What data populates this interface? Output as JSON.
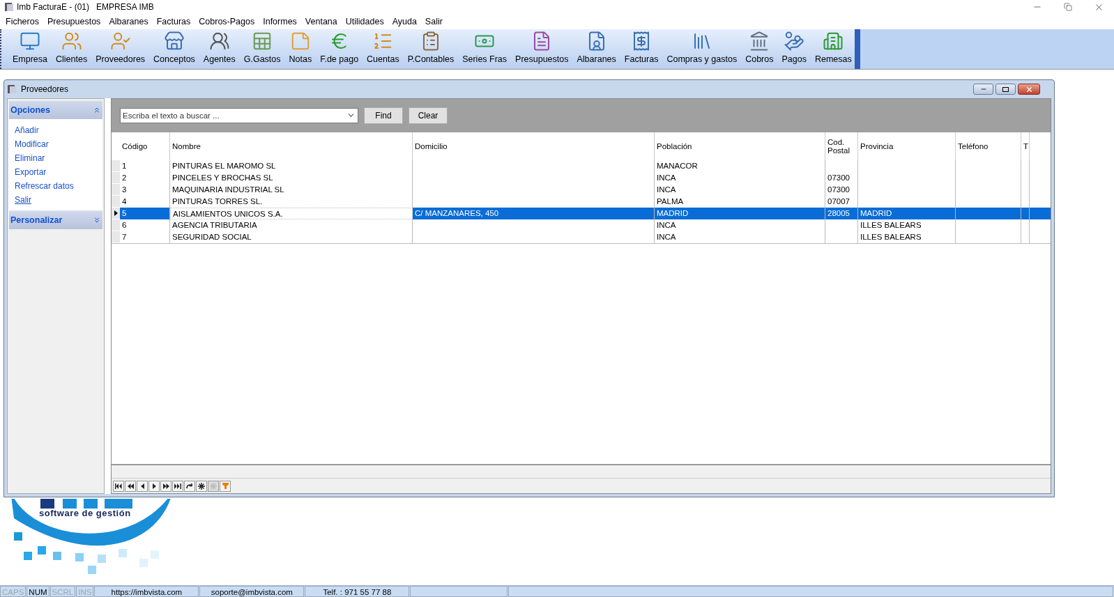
{
  "window": {
    "title": "Imb FacturaE - (01)   EMPRESA IMB"
  },
  "menu": [
    "Ficheros",
    "Presupuestos",
    "Albaranes",
    "Facturas",
    "Cobros-Pagos",
    "Informes",
    "Ventana",
    "Utilidades",
    "Ayuda",
    "Salir"
  ],
  "toolbar": [
    "Empresa",
    "Clientes",
    "Proveedores",
    "Conceptos",
    "Agentes",
    "G.Gastos",
    "Notas",
    "F.de pago",
    "Cuentas",
    "P.Contables",
    "Series Fras",
    "Presupuestos",
    "Albaranes",
    "Facturas",
    "Compras y gastos",
    "Cobros",
    "Pagos",
    "Remesas"
  ],
  "child_window": {
    "title": "Proveedores"
  },
  "sidebar": [
    {
      "title": "Opciones",
      "expanded": true,
      "items": [
        {
          "label": "Añadir",
          "underlined": false
        },
        {
          "label": "Modificar",
          "underlined": false
        },
        {
          "label": "Eliminar",
          "underlined": false
        },
        {
          "label": "Exportar",
          "underlined": false
        },
        {
          "label": "Refrescar datos",
          "underlined": false
        },
        {
          "label": "Salir",
          "underlined": true
        }
      ]
    },
    {
      "title": "Personalizar",
      "expanded": false
    }
  ],
  "search": {
    "placeholder": "Escriba el texto a buscar ...",
    "buttons": [
      "Find",
      "Clear"
    ]
  },
  "table": {
    "columns": [
      "Código",
      "Nombre",
      "Domicilio",
      "Población",
      "Cod. Postal",
      "Provincia",
      "Teléfono",
      "T"
    ],
    "rows": [
      {
        "selected": false,
        "cells": [
          {
            "text": "1",
            "focused": false
          },
          {
            "text": "PINTURAS EL MAROMO SL",
            "focused": false
          },
          {
            "focused": false
          },
          {
            "text": "MANACOR",
            "focused": false
          },
          {
            "focused": false
          },
          {
            "focused": false
          },
          {
            "focused": false
          },
          {
            "focused": false
          }
        ]
      },
      {
        "selected": false,
        "cells": [
          {
            "text": "2",
            "focused": false
          },
          {
            "text": "PINCELES Y BROCHAS SL",
            "focused": false
          },
          {
            "focused": false
          },
          {
            "text": "INCA",
            "focused": false
          },
          {
            "text": "07300",
            "focused": false
          },
          {
            "focused": false
          },
          {
            "focused": false
          },
          {
            "focused": false
          }
        ]
      },
      {
        "selected": false,
        "cells": [
          {
            "text": "3",
            "focused": false
          },
          {
            "text": "MAQUINARIA INDUSTRIAL SL",
            "focused": false
          },
          {
            "focused": false
          },
          {
            "text": "INCA",
            "focused": false
          },
          {
            "text": "07300",
            "focused": false
          },
          {
            "focused": false
          },
          {
            "focused": false
          },
          {
            "focused": false
          }
        ]
      },
      {
        "selected": false,
        "cells": [
          {
            "text": "4",
            "focused": false
          },
          {
            "text": "PINTURAS TORRES SL.",
            "focused": false
          },
          {
            "focused": false
          },
          {
            "text": "PALMA",
            "focused": false
          },
          {
            "text": "07007",
            "focused": false
          },
          {
            "focused": false
          },
          {
            "focused": false
          },
          {
            "focused": false
          }
        ]
      },
      {
        "selected": true,
        "cells": [
          {
            "text": "5",
            "focused": false
          },
          {
            "text": "AISLAMIENTOS UNICOS S.A.",
            "focused": true
          },
          {
            "text": "C/ MANZANARES, 450",
            "focused": false
          },
          {
            "text": "MADRID",
            "focused": false
          },
          {
            "text": "28005",
            "focused": false
          },
          {
            "text": "MADRID",
            "focused": false
          },
          {
            "focused": false
          },
          {
            "focused": false
          }
        ]
      },
      {
        "selected": false,
        "cells": [
          {
            "text": "6",
            "focused": false
          },
          {
            "text": "AGENCIA TRIBUTARIA",
            "focused": false
          },
          {
            "focused": false
          },
          {
            "text": "INCA",
            "focused": false
          },
          {
            "focused": false
          },
          {
            "text": "ILLES BALEARS",
            "focused": false
          },
          {
            "focused": false
          },
          {
            "focused": false
          }
        ]
      },
      {
        "selected": false,
        "cells": [
          {
            "text": "7",
            "focused": false
          },
          {
            "text": "SEGURIDAD SOCIAL",
            "focused": false
          },
          {
            "focused": false
          },
          {
            "text": "INCA",
            "focused": false
          },
          {
            "focused": false
          },
          {
            "text": "ILLES BALEARS",
            "focused": false
          },
          {
            "focused": false
          },
          {
            "focused": false
          }
        ]
      }
    ]
  },
  "navigator": [
    {
      "kind": "first",
      "disabled": false
    },
    {
      "kind": "prior-page",
      "disabled": false
    },
    {
      "kind": "prior",
      "disabled": false
    },
    {
      "kind": "next",
      "disabled": false
    },
    {
      "kind": "next-page",
      "disabled": false
    },
    {
      "kind": "last",
      "disabled": false
    },
    {
      "kind": "refresh",
      "disabled": false
    },
    {
      "kind": "apply",
      "disabled": false
    },
    {
      "kind": "cancel",
      "disabled": true
    },
    {
      "kind": "filter",
      "disabled": false
    }
  ],
  "logo": {
    "tagline": "software de gestión"
  },
  "status_bar": [
    {
      "kind": "indicator",
      "text": "CAPS",
      "on": false
    },
    {
      "kind": "indicator",
      "text": "NUM",
      "on": true
    },
    {
      "kind": "indicator",
      "text": "SCRL",
      "on": false
    },
    {
      "kind": "indicator",
      "text": "INS",
      "on": false
    },
    {
      "kind": "text",
      "text": "https://imbvista.com"
    },
    {
      "kind": "text",
      "text": "soporte@imbvista.com"
    },
    {
      "kind": "text",
      "text": "Telf. : 971 55 77 88"
    },
    {
      "kind": "empty"
    },
    {
      "kind": "empty"
    }
  ]
}
